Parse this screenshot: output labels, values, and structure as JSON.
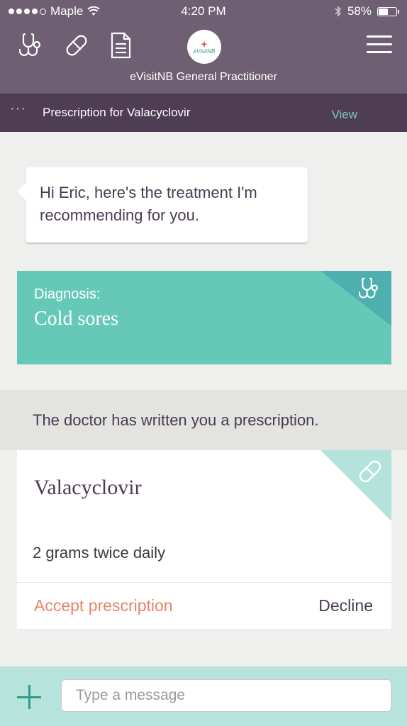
{
  "status_bar": {
    "carrier": "Maple",
    "time": "4:20 PM",
    "battery": "58%",
    "battery_level": 0.58
  },
  "header": {
    "title": "eVisitNB General Practitioner",
    "logo_text": "eVisitNB",
    "icons": [
      "stethoscope-icon",
      "pill-icon",
      "document-icon"
    ],
    "menu_icon": "hamburger-menu-icon"
  },
  "subbar": {
    "more": "···",
    "title": "Prescription for Valacyclovir",
    "view_label": "View"
  },
  "chat": {
    "message": "Hi Eric, here's the treatment I'm recommending for you."
  },
  "diagnosis": {
    "label": "Diagnosis:",
    "value": "Cold sores",
    "icon": "stethoscope-icon"
  },
  "prescription_notice": "The doctor has written you a prescription.",
  "prescription": {
    "drug": "Valacyclovir",
    "dose": "2 grams twice daily",
    "accept_label": "Accept prescription",
    "decline_label": "Decline",
    "icon": "pill-icon"
  },
  "composer": {
    "placeholder": "Type a message"
  },
  "colors": {
    "header": "#6e5f73",
    "subbar": "#4e3d53",
    "teal": "#66c9b7",
    "accent": "#e8836a"
  }
}
